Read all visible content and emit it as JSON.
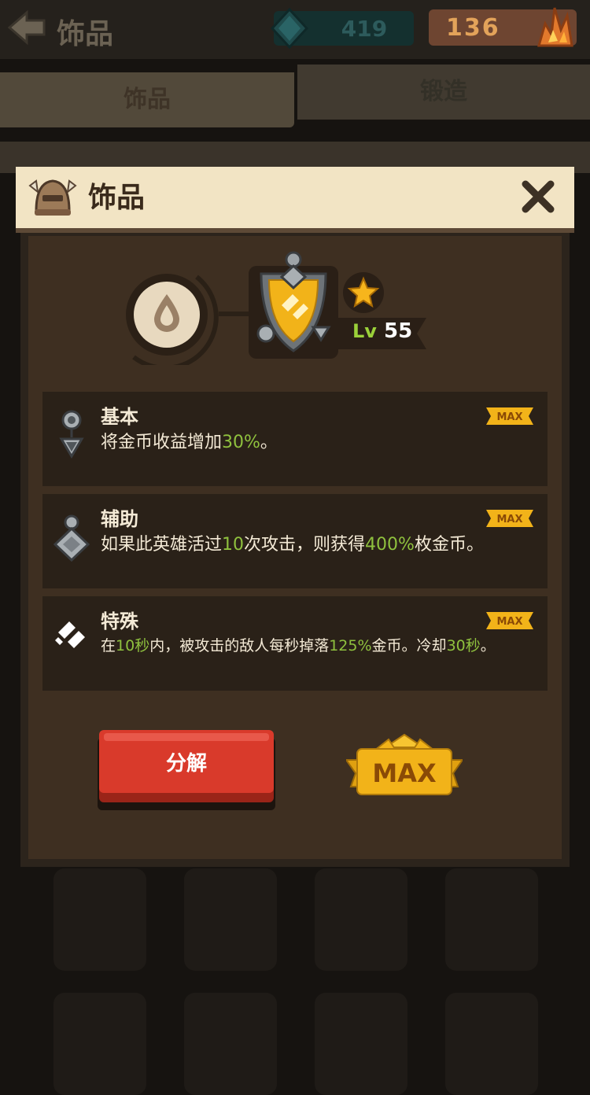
{
  "header": {
    "title": "饰品",
    "gems": "419",
    "crystals": "136"
  },
  "tabs": [
    {
      "label": "饰品"
    },
    {
      "label": "锻造"
    }
  ],
  "modal": {
    "title": "饰品",
    "level_prefix": "Lv",
    "level": "55",
    "stats": [
      {
        "name": "基本",
        "desc_parts": [
          "将金币收益增加",
          "30%",
          "。"
        ],
        "tag": "MAX",
        "icon": "pendant-icon"
      },
      {
        "name": "辅助",
        "desc_parts": [
          "如果此英雄活过",
          "10",
          "次攻击，则获得",
          "400%",
          "枚金币。"
        ],
        "tag": "MAX",
        "icon": "diamond-gem-icon"
      },
      {
        "name": "特殊",
        "desc_parts": [
          "在",
          "10秒",
          "内，被攻击的敌人每秒掉落",
          "125%",
          "金币。冷却",
          "30秒",
          "。"
        ],
        "tag": "MAX",
        "icon": "chain-emblem-icon"
      }
    ],
    "decompose_label": "分解",
    "max_badge": "MAX"
  },
  "colors": {
    "highlight": "#8fc13e",
    "header_bg": "#f2e4c4",
    "button_red": "#d93a2b",
    "gold": "#f2b319"
  }
}
